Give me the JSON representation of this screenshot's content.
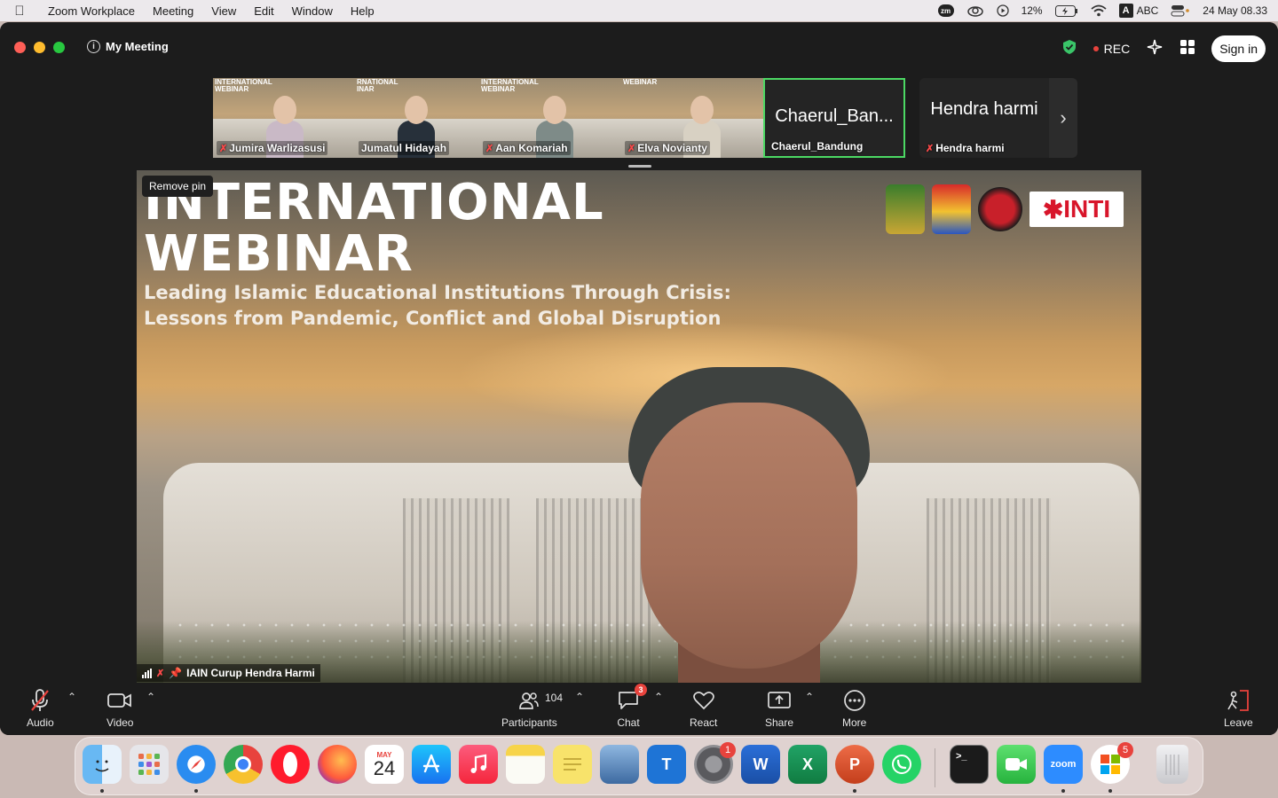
{
  "menubar": {
    "app_name": "Zoom Workplace",
    "menus": [
      "Meeting",
      "View",
      "Edit",
      "Window",
      "Help"
    ],
    "status": {
      "zm_label": "zm",
      "battery_percent": "12%",
      "input_letter": "A",
      "input_source": "ABC",
      "datetime": "24 May  08.33"
    }
  },
  "window": {
    "meeting_title": "My Meeting",
    "info_glyph": "i",
    "rec_label": "REC",
    "signin_label": "Sign in"
  },
  "thumbnails": [
    {
      "name": "Jumira Warlizasusi",
      "header": "INTERNATIONAL WEBINAR",
      "muted": true,
      "clothing": "#c9b9c6"
    },
    {
      "name": "Jumatul Hidayah",
      "header": "RNATIONAL INAR",
      "muted": false,
      "clothing": "#27303a"
    },
    {
      "name": "Aan Komariah",
      "header": "INTERNATIONAL WEBINAR",
      "muted": true,
      "clothing": "#7e8b88"
    },
    {
      "name": "Elva Novianty",
      "header": "WEBINAR",
      "muted": true,
      "clothing": "#d8d1c3"
    },
    {
      "name": "Chaerul_Bandung",
      "big_label": "Chaerul_Ban...",
      "muted": false,
      "active": true
    },
    {
      "name": "Hendra harmi",
      "big_label": "Hendra harmi",
      "muted": true
    }
  ],
  "main_video": {
    "remove_pin_label": "Remove pin",
    "slide_title_line1": "INTERNATIONAL",
    "slide_title_line2": "WEBINAR",
    "slide_subtitle_line1": "Leading Islamic Educational Institutions Through Crisis:",
    "slide_subtitle_line2": "Lessons from Pandemic, Conflict and Global Disruption",
    "logo_text": "INTI",
    "speaker_name": "IAIN Curup Hendra Harmi"
  },
  "toolbar": {
    "audio_label": "Audio",
    "video_label": "Video",
    "participants_label": "Participants",
    "participants_count": "104",
    "chat_label": "Chat",
    "chat_badge": "3",
    "react_label": "React",
    "share_label": "Share",
    "more_label": "More",
    "leave_label": "Leave"
  },
  "dock": {
    "calendar_month": "MAY",
    "calendar_day": "24",
    "settings_badge": "1",
    "office_badge": "5",
    "word_letter": "W",
    "excel_letter": "X",
    "powerpoint_letter": "P",
    "trello_letter": "T",
    "zoom_label": "zoom",
    "terminal_prompt": ">_"
  },
  "colors": {
    "zoom_bg": "#1c1c1c",
    "rec_red": "#e8433d",
    "active_green": "#4cd964",
    "shield_green": "#3ac569"
  }
}
